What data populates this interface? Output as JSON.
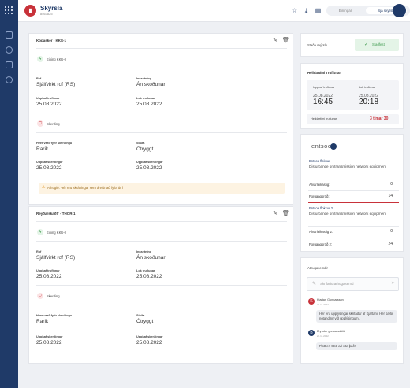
{
  "header": {
    "title": "Skýrsla",
    "subtitle": "8567825",
    "toggle_left": "Einingar",
    "toggle_right": "Sjá skýrslu"
  },
  "cards": [
    {
      "title": "Kopasker - KKS-1",
      "unit": "Eining KKS-0",
      "fields": {
        "row1_left_label": "Ref",
        "row1_left_value": "Sjálfvirkt rof (RS)",
        "row1_right_label": "Innsetning",
        "row1_right_value": "Án skoðunar",
        "row2_left_label": "Upphaf truflunar",
        "row2_left_value": "25.08.2022",
        "row2_right_label": "Lok truflunar",
        "row2_right_value": "25.08.2022"
      },
      "section": "Skerðing",
      "skerding": {
        "row1_left_label": "Hver varð fyrir skerðingu",
        "row1_left_value": "Rarik",
        "row1_right_label": "Staða",
        "row1_right_value": "Ótryggt",
        "row2_left_label": "Upphaf skerðingar",
        "row2_left_value": "25.08.2022",
        "row2_right_label": "Upphaf skerðingar",
        "row2_right_value": "25.08.2022"
      },
      "warning": "Athugið. Hér eru skráningar sem á eftir að fylla út í"
    },
    {
      "title": "Reyðarskaðfr - THOR-1",
      "unit": "Eining KKS-0",
      "fields": {
        "row1_left_label": "Rof",
        "row1_left_value": "Sjálfvirkt rof (RS)",
        "row1_right_label": "Innsetning",
        "row1_right_value": "Án skoðunar",
        "row2_left_label": "Upphaf truflunar",
        "row2_left_value": "25.08.2022",
        "row2_right_label": "Lok truflunar",
        "row2_right_value": "25.08.2022"
      },
      "section": "Skerðing",
      "skerding": {
        "row1_left_label": "Hver varð fyrir skerðingu",
        "row1_left_value": "Rarik",
        "row1_right_label": "Staða",
        "row1_right_value": "Ótryggt",
        "row2_left_label": "Upphaf skerðingar",
        "row2_left_value": "25.08.2022",
        "row2_right_label": "Upphaf skerðingar",
        "row2_right_value": "25.08.2022"
      }
    }
  ],
  "status": {
    "label": "Staða skýrslu",
    "value": "Staðfest"
  },
  "disturbance": {
    "title": "Heildartími Truflunar",
    "start_label": "Upphaf truflunar",
    "start_date": "25.08.2022",
    "start_time": "16:45",
    "end_label": "Lok truflunar",
    "end_date": "25.08.2022",
    "end_time": "20:18",
    "total_label": "Heildartími truflunar",
    "total_value": "3 tímar 30"
  },
  "entsoe": {
    "logo": "entsoe",
    "cat1_label": "Entsoe flokkur",
    "cat1_value": "Disturbance on transmission network equipment",
    "alv1_label": "Alvarleikastig:",
    "alv1_value": "0",
    "forg1_label": "Forgangsröð:",
    "forg1_value": "14",
    "cat2_label": "Entsoe flokkur 2",
    "cat2_value": "Disturbance on transmission network equipment",
    "alv2_label": "Alvarleikastig 2:",
    "alv2_value": "0",
    "forg2_label": "Forgangsröð 2:",
    "forg2_value": "24"
  },
  "comments": {
    "title": "Athugasemdir",
    "placeholder": "Skrifaðu athugasemd",
    "items": [
      {
        "initial": "K",
        "name": "Kjartan Gunnarsson",
        "date": "24.11.2022",
        "text": "Hér eru upplýsingar skrifaðar af Kjartani. Hér bætir notandinn við upplýsingum."
      },
      {
        "initial": "B",
        "name": "Bryndur gunnarsdóttir",
        "date": "24.11.2022",
        "text": "Flott er, Gott að vita það!"
      }
    ]
  }
}
